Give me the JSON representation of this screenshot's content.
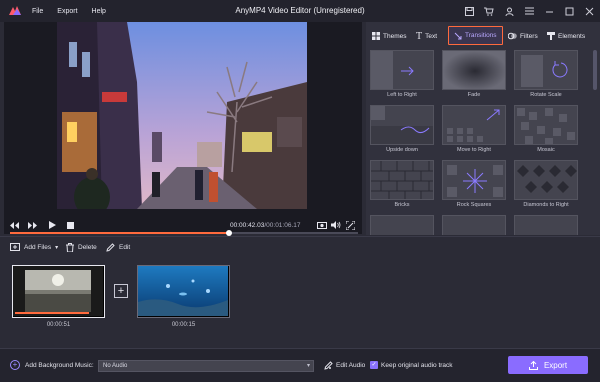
{
  "app": {
    "title": "AnyMP4 Video Editor (Unregistered)"
  },
  "menu": {
    "items": [
      "File",
      "Export",
      "Help"
    ]
  },
  "window_icons": [
    "save-icon",
    "cart-icon",
    "user-icon",
    "menu-icon",
    "minimize-icon",
    "maximize-icon",
    "close-icon"
  ],
  "player": {
    "current_time": "00:00:42.03",
    "total_time": "00:01:06.17",
    "separator": "/",
    "progress": 0.63
  },
  "panel": {
    "tabs": [
      {
        "label": "Themes",
        "icon": "themes-icon"
      },
      {
        "label": "Text",
        "icon": "text-icon"
      },
      {
        "label": "Transitions",
        "icon": "transitions-icon",
        "active": true
      },
      {
        "label": "Filters",
        "icon": "filters-icon"
      },
      {
        "label": "Elements",
        "icon": "elements-icon"
      }
    ],
    "transitions": [
      {
        "label": "Left to Right"
      },
      {
        "label": "Fade"
      },
      {
        "label": "Rotate Scale"
      },
      {
        "label": "Upside down"
      },
      {
        "label": "Move to Right"
      },
      {
        "label": "Mosaic"
      },
      {
        "label": "Bricks"
      },
      {
        "label": "Rock Squares"
      },
      {
        "label": "Diamonds to Right"
      }
    ]
  },
  "edit_toolbar": {
    "add_files": "Add Files",
    "delete": "Delete",
    "edit": "Edit"
  },
  "timeline": {
    "clips": [
      {
        "duration": "00:00:51"
      },
      {
        "duration": "00:00:15"
      }
    ]
  },
  "bottom": {
    "add_bg_music": "Add Background Music:",
    "audio_value": "No Audio",
    "edit_audio": "Edit Audio",
    "keep_audio": "Keep original audio track",
    "export": "Export"
  },
  "colors": {
    "accent": "#8a6cff",
    "highlight": "#ff6a3d"
  }
}
